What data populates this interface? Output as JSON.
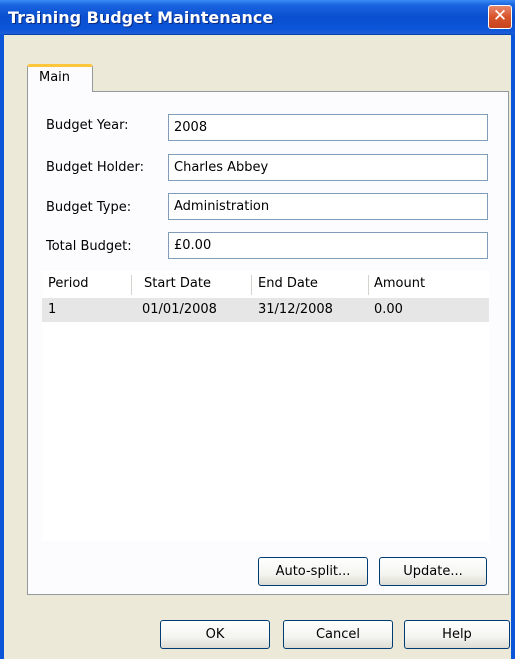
{
  "window": {
    "title": "Training Budget Maintenance",
    "close_glyph": "✕"
  },
  "tabs": [
    {
      "label": "Main",
      "selected": true
    }
  ],
  "fields": {
    "budget_year": {
      "label": "Budget Year:",
      "value": "2008"
    },
    "budget_holder": {
      "label": "Budget Holder:",
      "value": "Charles Abbey"
    },
    "budget_type": {
      "label": "Budget Type:",
      "value": "Administration"
    },
    "total_budget": {
      "label": "Total Budget:",
      "value": "£0.00"
    }
  },
  "periods_table": {
    "columns": [
      "Period",
      "Start Date",
      "End Date",
      "Amount"
    ],
    "rows": [
      {
        "period": "1",
        "start_date": "01/01/2008",
        "end_date": "31/12/2008",
        "amount": "0.00"
      }
    ]
  },
  "buttons": {
    "auto_split": "Auto-split...",
    "update": "Update...",
    "ok": "OK",
    "cancel": "Cancel",
    "help": "Help"
  },
  "colors": {
    "titlebar": "#0b55d8",
    "tab_accent": "#ffc83c",
    "selected_row": "#e6e6e6"
  }
}
